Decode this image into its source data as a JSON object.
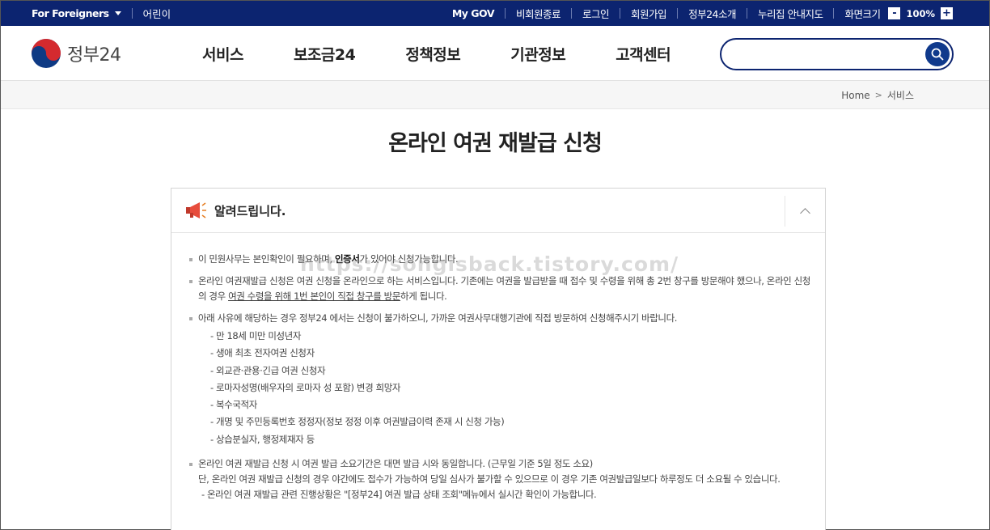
{
  "topbar": {
    "foreigners": "For Foreigners",
    "kids": "어린이",
    "links": [
      "My GOV",
      "비회원종료",
      "로그인",
      "회원가입",
      "정부24소개",
      "누리집 안내지도"
    ],
    "zoom_label": "화면크기",
    "zoom_minus": "-",
    "zoom_value": "100%",
    "zoom_plus": "+"
  },
  "header": {
    "logo_text": "정부24",
    "nav": [
      "서비스",
      "보조금24",
      "정책정보",
      "기관정보",
      "고객센터"
    ],
    "search_value": ""
  },
  "breadcrumb": {
    "home": "Home",
    "current": "서비스"
  },
  "page_title": "온라인 여권 재발급 신청",
  "notice": {
    "title": "알려드립니다.",
    "p1_a": "이 민원사무는 본인확인이 필요하며, ",
    "p1_b": "인증서",
    "p1_c": "가 있어야 신청가능합니다.",
    "p2_a": "온라인 여권재발급 신청은 여권 신청을 온라인으로 하는 서비스입니다. 기존에는 여권을 발급받을 때 접수 및 수령을 위해 총 2번 창구를 방문해야 했으나, 온라인 신청의 경우 ",
    "p2_b": "여권 수령을 위해 1번 본인이 직접 창구를 방문",
    "p2_c": "하게 됩니다.",
    "p3": "아래 사유에 해당하는 경우 정부24 에서는 신청이 불가하오니, 가까운 여권사무대행기관에 직접 방문하여 신청해주시기 바랍니다.",
    "p3_items": [
      "- 만 18세 미만 미성년자",
      "- 생애 최초 전자여권 신청자",
      "- 외교관·관용·긴급 여권 신청자",
      "- 로마자성명(배우자의 로마자 성 포함) 변경 희망자",
      "- 복수국적자",
      "- 개명 및 주민등록번호 정정자(정보 정정 이후 여권발급이력 존재 시 신청 가능)",
      "- 상습분실자, 행정제재자 등"
    ],
    "p4_line1": "온라인 여권 재발급 신청 시 여권 발급 소요기간은 대면 발급 시와 동일합니다. (근무일 기준 5일 정도 소요)",
    "p4_line2": "단, 온라인 여권 재발급 신청의 경우 야간에도 접수가 가능하여 당일 심사가 불가할 수 있으므로 이 경우 기존 여권발급일보다 하루정도 더 소요될 수 있습니다.",
    "p4_sub": "- 온라인 여권 재발급 관련 진행상황은 \"[정부24] 여권 발급 상태 조회\"메뉴에서 실시간 확인이 가능합니다."
  },
  "watermark": "https://songisback.tistory.com/",
  "colors": {
    "navy": "#0c2470",
    "search_btn": "#103a8c",
    "logo_red": "#d42a2f",
    "logo_blue": "#0e3a84"
  },
  "icons": [
    "caret-down-icon",
    "search-icon",
    "megaphone-icon",
    "chevron-up-icon"
  ]
}
